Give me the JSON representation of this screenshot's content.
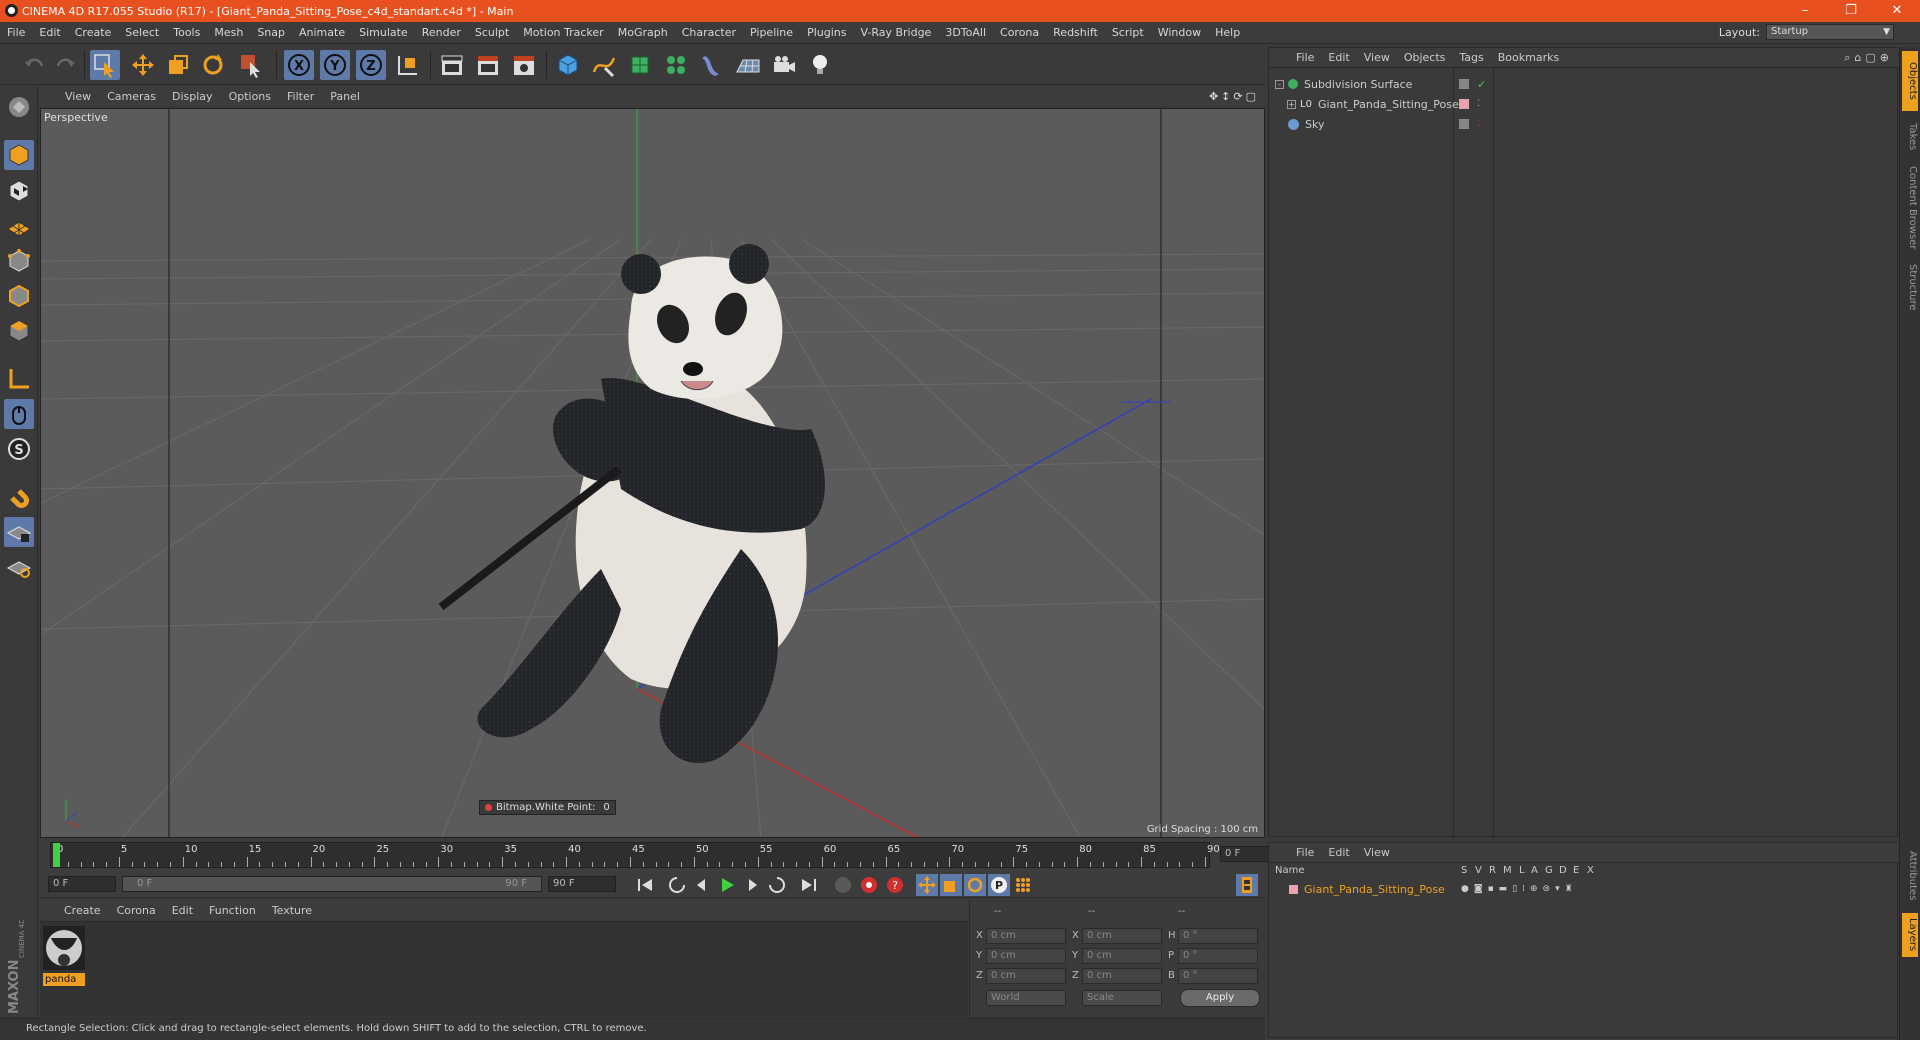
{
  "window": {
    "title": "CINEMA 4D R17.055 Studio (R17) - [Giant_Panda_Sitting_Pose_c4d_standart.c4d *] - Main",
    "controls": [
      "–",
      "❐",
      "✕"
    ]
  },
  "menubar": {
    "items": [
      "File",
      "Edit",
      "Create",
      "Select",
      "Tools",
      "Mesh",
      "Snap",
      "Animate",
      "Simulate",
      "Render",
      "Sculpt",
      "Motion Tracker",
      "MoGraph",
      "Character",
      "Pipeline",
      "Plugins",
      "V-Ray Bridge",
      "3DToAll",
      "Corona",
      "Redshift",
      "Script",
      "Window",
      "Help"
    ],
    "layout_label": "Layout:",
    "layout_value": "Startup"
  },
  "viewport": {
    "menu": [
      "View",
      "Cameras",
      "Display",
      "Options",
      "Filter",
      "Panel"
    ],
    "camera_label": "Perspective",
    "grid_spacing": "Grid Spacing : 100 cm",
    "bitmap_label": "Bitmap.White Point:",
    "bitmap_value": "0"
  },
  "timeline": {
    "ticks": [
      "0",
      "5",
      "10",
      "15",
      "20",
      "25",
      "30",
      "35",
      "40",
      "45",
      "50",
      "55",
      "60",
      "65",
      "70",
      "75",
      "80",
      "85",
      "90"
    ],
    "current_frame": "0 F",
    "start_field": "0 F",
    "range_start": "0 F",
    "range_end": "90 F",
    "end_field": "90 F",
    "max_frame": 90,
    "playhead_frame": 0
  },
  "material_manager": {
    "menu": [
      "Create",
      "Corona",
      "Edit",
      "Function",
      "Texture"
    ],
    "materials": [
      {
        "name": "panda"
      }
    ]
  },
  "coordinates": {
    "headers": [
      "--",
      "--",
      "--"
    ],
    "rows": [
      {
        "a": "X",
        "av": "0 cm",
        "b": "X",
        "bv": "0 cm",
        "c": "H",
        "cv": "0 °"
      },
      {
        "a": "Y",
        "av": "0 cm",
        "b": "Y",
        "bv": "0 cm",
        "c": "P",
        "cv": "0 °"
      },
      {
        "a": "Z",
        "av": "0 cm",
        "b": "Z",
        "bv": "0 cm",
        "c": "B",
        "cv": "0 °"
      }
    ],
    "mode1": "World",
    "mode2": "Scale",
    "apply": "Apply"
  },
  "object_manager": {
    "menu": [
      "File",
      "Edit",
      "View",
      "Objects",
      "Tags",
      "Bookmarks"
    ],
    "objects": [
      {
        "name": "Subdivision Surface",
        "icon": "subdivision-icon"
      },
      {
        "name": "Giant_Panda_Sitting_Pose",
        "icon": "null-object-icon"
      },
      {
        "name": "Sky",
        "icon": "sky-icon"
      }
    ]
  },
  "layer_manager": {
    "menu": [
      "File",
      "Edit",
      "View"
    ],
    "columns": [
      "Name",
      "S",
      "V",
      "R",
      "M",
      "L",
      "A",
      "G",
      "D",
      "E",
      "X"
    ],
    "layers": [
      {
        "name": "Giant_Panda_Sitting_Pose",
        "color": "#e8a2b0"
      }
    ]
  },
  "right_tabs": [
    "Objects",
    "Takes",
    "Content Browser",
    "Structure",
    "Attributes",
    "Layers"
  ],
  "status": "Rectangle Selection: Click and drag to rectangle-select elements. Hold down SHIFT to add to the selection, CTRL to remove.",
  "colors": {
    "titlebar": "#e8501f",
    "accent_orange": "#f0a020",
    "axis_x": "#c03030",
    "axis_y": "#30b030",
    "axis_z": "#3040c0"
  }
}
